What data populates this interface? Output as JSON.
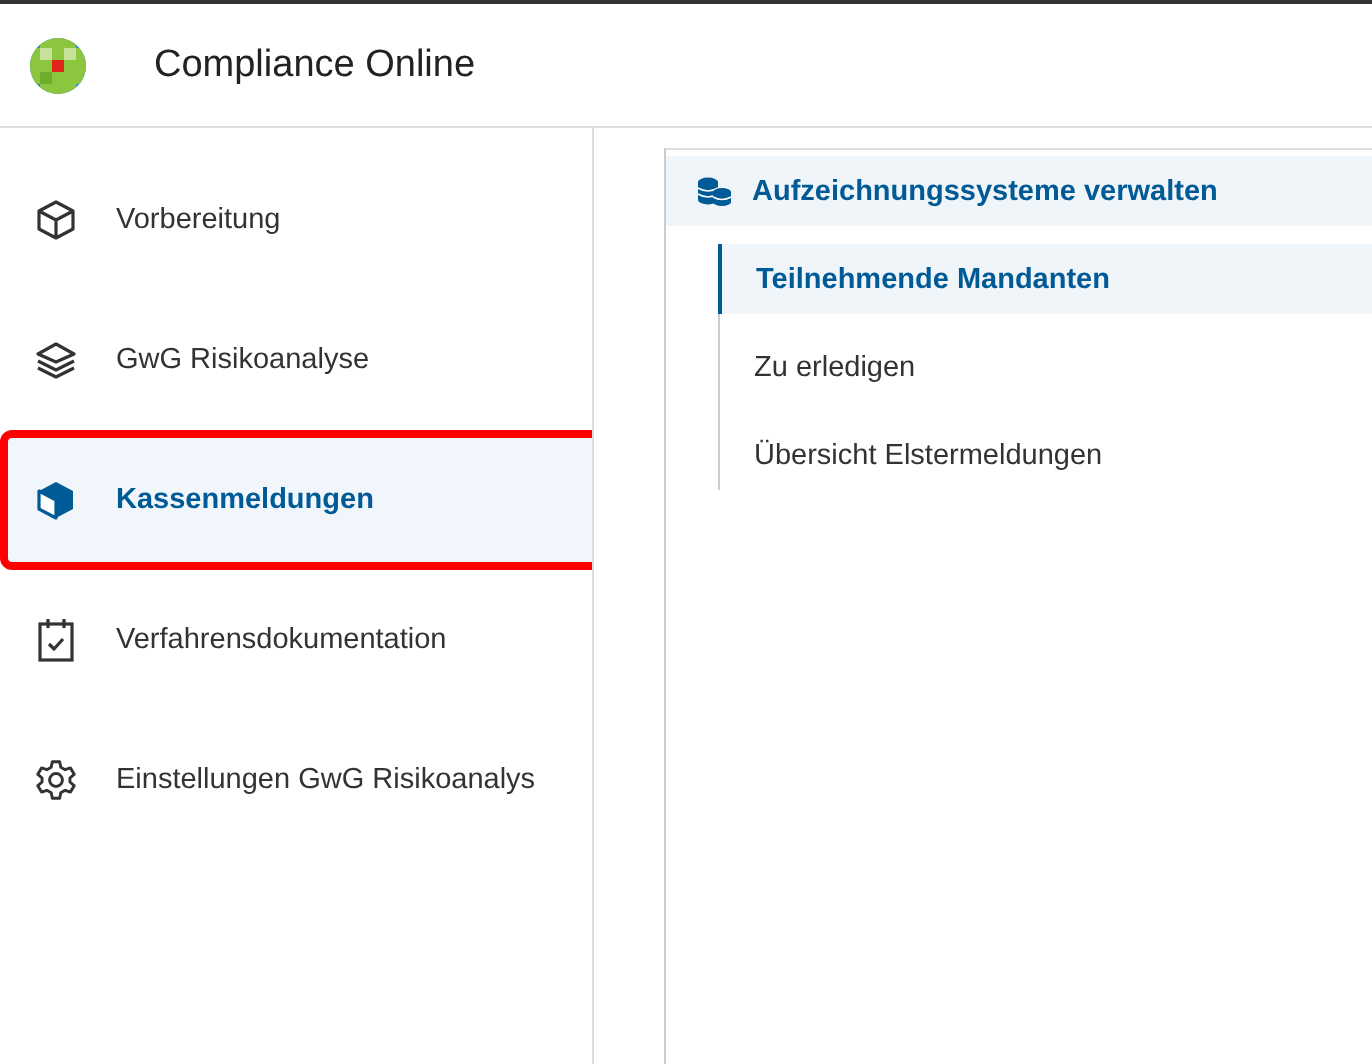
{
  "app": {
    "title": "Compliance Online"
  },
  "sidebar": {
    "items": [
      {
        "kind": "cube",
        "label": "Vorbereitung",
        "selected": false,
        "highlighted": false
      },
      {
        "kind": "layers",
        "label": "GwG Risikoanalyse",
        "selected": false,
        "highlighted": false
      },
      {
        "kind": "solid-cube",
        "label": "Kassenmeldungen",
        "selected": true,
        "highlighted": true
      },
      {
        "kind": "calendar",
        "label": "Verfahrensdokumentation",
        "selected": false,
        "highlighted": false
      },
      {
        "kind": "gear",
        "label": "Einstellungen GwG Risikoanalys",
        "selected": false,
        "highlighted": false
      }
    ]
  },
  "submenu": {
    "heading": "Aufzeichnungssysteme verwalten",
    "items": [
      {
        "label": "Teilnehmende Mandanten",
        "selected": true
      },
      {
        "label": "Zu erledigen",
        "selected": false
      },
      {
        "label": "Übersicht Elstermeldungen",
        "selected": false
      }
    ]
  }
}
